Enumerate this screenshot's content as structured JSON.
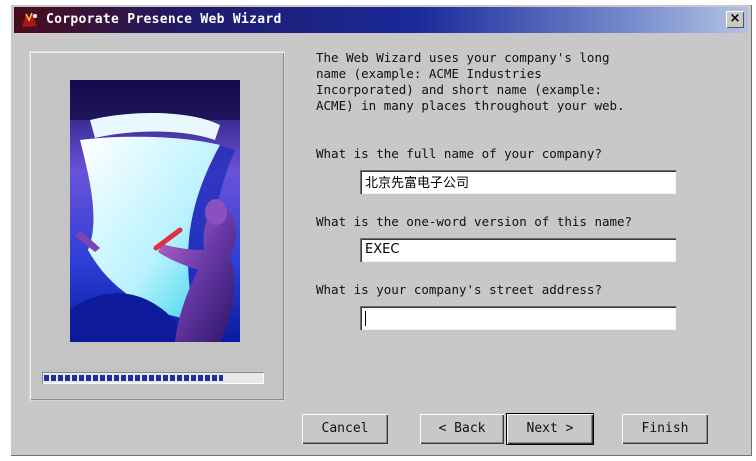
{
  "window": {
    "title": "Corporate Presence Web Wizard",
    "close_glyph": "×"
  },
  "progress": {
    "fraction": 0.82
  },
  "intro_text": "The Web Wizard uses your company's long\nname (example: ACME Industries\nIncorporated) and short name (example:\nACME) in many places throughout your web.",
  "questions": [
    {
      "label": "What is the full name of your company?",
      "value": "北京先富电子公司"
    },
    {
      "label": "What is the one-word version of this name?",
      "value": "EXEC"
    },
    {
      "label": "What is your company's street address?",
      "value": ""
    }
  ],
  "buttons": {
    "cancel": "Cancel",
    "back": "< Back",
    "next": "Next >",
    "finish": "Finish"
  },
  "colors": {
    "titlebar_start": "#4a0d1a",
    "titlebar_mid": "#1a2a9a",
    "titlebar_end": "#b4c3e2",
    "progress": "#1d2fa3",
    "dialog_bg": "#c8c8c8"
  }
}
